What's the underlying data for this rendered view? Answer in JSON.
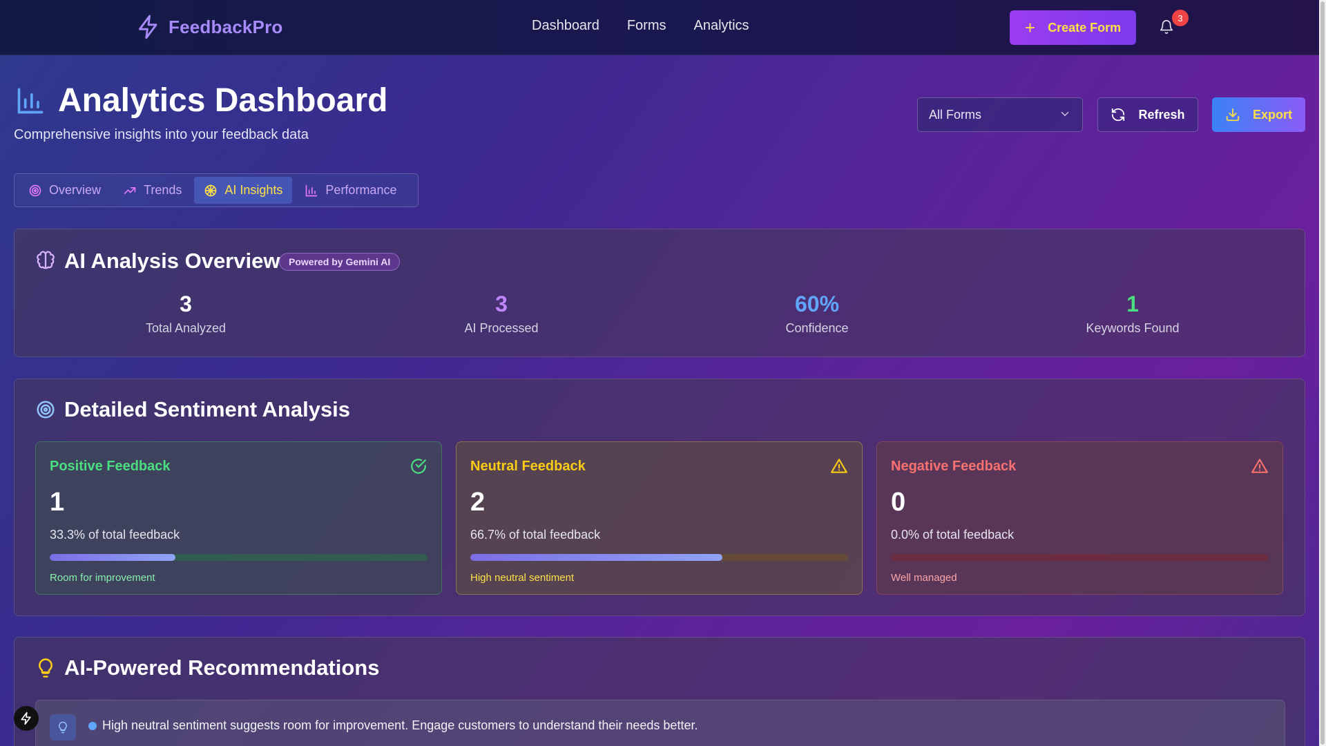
{
  "nav": {
    "brand": "FeedbackPro",
    "links": [
      "Dashboard",
      "Forms",
      "Analytics"
    ],
    "create_label": "Create Form",
    "notification_count": "3"
  },
  "header": {
    "title": "Analytics Dashboard",
    "subtitle": "Comprehensive insights into your feedback data",
    "form_filter": "All Forms",
    "refresh_label": "Refresh",
    "export_label": "Export"
  },
  "tabs": [
    {
      "label": "Overview",
      "icon": "target-icon"
    },
    {
      "label": "Trends",
      "icon": "trend-icon"
    },
    {
      "label": "AI Insights",
      "icon": "brain-icon",
      "active": true
    },
    {
      "label": "Performance",
      "icon": "bar-chart-icon"
    }
  ],
  "ai_overview": {
    "title": "AI Analysis Overview",
    "badge": "Powered by Gemini AI",
    "stats": [
      {
        "value": "3",
        "label": "Total Analyzed",
        "color": "#ffffff"
      },
      {
        "value": "3",
        "label": "AI Processed",
        "color": "#c084fc"
      },
      {
        "value": "60%",
        "label": "Confidence",
        "color": "#60a5fa"
      },
      {
        "value": "1",
        "label": "Keywords Found",
        "color": "#4ade80"
      }
    ]
  },
  "sentiment": {
    "title": "Detailed Sentiment Analysis",
    "cards": [
      {
        "title": "Positive Feedback",
        "count": "1",
        "percent_text": "33.3% of total feedback",
        "fraction": 0.333,
        "note": "Room for improvement",
        "color": "#4ade80"
      },
      {
        "title": "Neutral Feedback",
        "count": "2",
        "percent_text": "66.7% of total feedback",
        "fraction": 0.667,
        "note": "High neutral sentiment",
        "color": "#facc15"
      },
      {
        "title": "Negative Feedback",
        "count": "0",
        "percent_text": "0.0% of total feedback",
        "fraction": 0.0,
        "note": "Well managed",
        "color": "#f87171"
      }
    ]
  },
  "recommendations": {
    "title": "AI-Powered Recommendations",
    "items": [
      "High neutral sentiment suggests room for improvement. Engage customers to understand their needs better."
    ]
  }
}
